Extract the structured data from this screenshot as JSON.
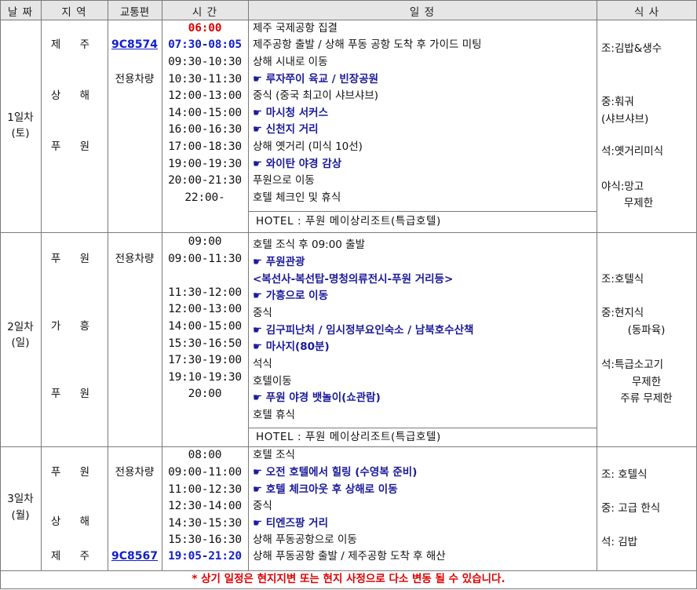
{
  "headers": {
    "date": "날 짜",
    "region": "지 역",
    "transport": "교통편",
    "time": "시 간",
    "schedule": "일 정",
    "meal": "식 사"
  },
  "days": [
    {
      "label": "1일차",
      "dow": "(토)",
      "regions": [
        "제 주",
        "상 해",
        "푸 원"
      ],
      "transport": [
        "9C8574",
        "전용차량"
      ],
      "times": [
        "06:00",
        "07:30-08:05",
        "09:30-10:30",
        "10:30-11:30",
        "12:00-13:00",
        "14:00-15:00",
        "16:00-16:30",
        "17:00-18:30",
        "19:00-19:30",
        "20:00-21:30",
        "22:00-"
      ],
      "items": [
        "제주 국제공항 집결",
        "제주공항 출발 / 상해 푸동 공항 도착 후 가이드 미팅",
        "상해 시내로 이동",
        "☛ 루자쭈이 육교 / 빈장공원",
        "중식 (중국 최고이 샤브샤브)",
        "☛ 마시청 서커스",
        "☛ 신천지 거리",
        "상해 옛거리 (미식 10선)",
        "☛ 와이탄 야경 감상",
        "푸원으로 이동",
        "호텔 체크인 및 휴식"
      ],
      "hotel": "HOTEL : 푸원 메이상리조트(특급호텔)",
      "meals": [
        "조:김밥&생수",
        "중:훠궈",
        "(샤브샤브)",
        "석:옛거리미식",
        "야식:망고",
        "무제한"
      ]
    },
    {
      "label": "2일차",
      "dow": "(일)",
      "regions": [
        "푸 원",
        "가 흥",
        "푸 원"
      ],
      "transport": [
        "전용차량"
      ],
      "times": [
        "09:00",
        "09:00-11:30",
        "11:30-12:00",
        "12:00-13:00",
        "14:00-15:00",
        "15:30-16:50",
        "17:30-19:00",
        "19:10-19:30",
        "20:00"
      ],
      "items": [
        "호텔 조식 후 09:00 출발",
        "☛ 푸원관광",
        "<복선사-복선탑-명청의류전시-푸원 거리등>",
        "☛ 가흥으로 이동",
        "중식",
        "☛ 김구피난처 / 임시정부요인숙소 / 남북호수산책",
        "☛ 마사지(80분)",
        "석식",
        "호텔이동",
        "☛ 푸원 야경 뱃놀이(쇼관람)",
        "호텔 휴식"
      ],
      "hotel": "HOTEL : 푸원 메이상리조트(특급호텔)",
      "meals": [
        "조:호텔식",
        "중:현지식",
        "(동파육)",
        "석:특급소고기",
        "무제한",
        "주류 무제한"
      ]
    },
    {
      "label": "3일차",
      "dow": "(월)",
      "regions": [
        "푸 원",
        "상 해",
        "제 주"
      ],
      "transport": [
        "전용차량",
        "9C8567"
      ],
      "times": [
        "08:00",
        "09:00-11:00",
        "11:00-12:30",
        "12:30-14:00",
        "14:30-15:30",
        "15:30-16:30",
        "19:05-21:20"
      ],
      "items": [
        "호텔 조식",
        "☛ 오전 호텔에서 힐링 (수영복 준비)",
        "☛ 호텔 체크아웃 후 상해로 이동",
        "중식",
        "☛ 티엔즈팡 거리",
        "상해 푸동공항으로 이동",
        "상해 푸동공항 출발 / 제주공항 도착 후 해산"
      ],
      "meals": [
        "조: 호텔식",
        "중: 고급 한식",
        "석: 김밥"
      ]
    }
  ],
  "notice": "* 상기 일정은 현지지변 또는 현지 사정으로 다소 변동 될 수 있습니다.",
  "colors": {
    "header_bg": "#e6e6e6",
    "accent_red": "#e00000",
    "link_blue": "#1520c8",
    "border": "#7a7a7a"
  }
}
